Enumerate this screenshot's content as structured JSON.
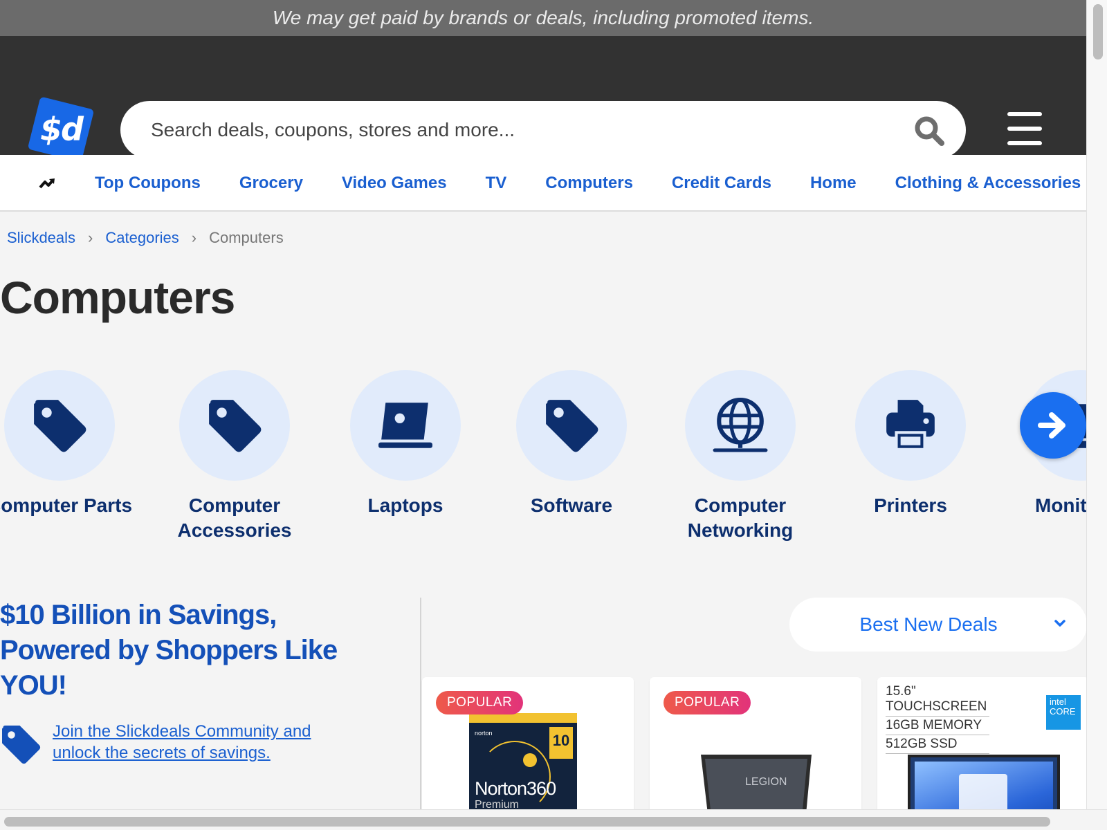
{
  "disclosure": "We may get paid by brands or deals, including promoted items.",
  "header": {
    "logo_text": "$d",
    "search_placeholder": "Search deals, coupons, stores and more..."
  },
  "nav": {
    "trend_icon": "trending-icon",
    "links": [
      "Top Coupons",
      "Grocery",
      "Video Games",
      "TV",
      "Computers",
      "Credit Cards",
      "Home",
      "Clothing & Accessories"
    ]
  },
  "breadcrumb": [
    "Slickdeals",
    "Categories",
    "Computers"
  ],
  "page_title": "Computers",
  "categories": [
    {
      "label": "Computer Parts",
      "icon": "tag-icon"
    },
    {
      "label": "Computer Accessories",
      "icon": "tag-icon"
    },
    {
      "label": "Laptops",
      "icon": "laptop-icon"
    },
    {
      "label": "Software",
      "icon": "tag-icon"
    },
    {
      "label": "Computer Networking",
      "icon": "globe-network-icon"
    },
    {
      "label": "Printers",
      "icon": "printer-icon"
    },
    {
      "label": "Monit",
      "icon": "monitor-icon"
    }
  ],
  "promo": {
    "headline": "$10 Billion in Savings, Powered by Shoppers Like YOU!",
    "link": "Join the Slickdeals Community and unlock the secrets of savings."
  },
  "sort": {
    "selected": "Best New Deals"
  },
  "deals": [
    {
      "badge": "POPULAR",
      "product_text": {
        "brand": "norton",
        "name": "Norton360",
        "tier": "Premium",
        "devices": "10"
      }
    },
    {
      "badge": "POPULAR",
      "product_text": {
        "brand": "LEGION"
      }
    },
    {
      "badge": "",
      "product_text": {
        "specs": [
          "15.6\" TOUCHSCREEN",
          "16GB MEMORY",
          "512GB SSD"
        ],
        "chip": "intel CORE"
      }
    }
  ],
  "colors": {
    "brand_blue": "#1a6ff0",
    "header_bg": "#323232",
    "link_blue": "#1a5fd0",
    "category_text": "#0d2f6e",
    "badge_gradient": [
      "#ee5a4a",
      "#e2337a"
    ]
  }
}
